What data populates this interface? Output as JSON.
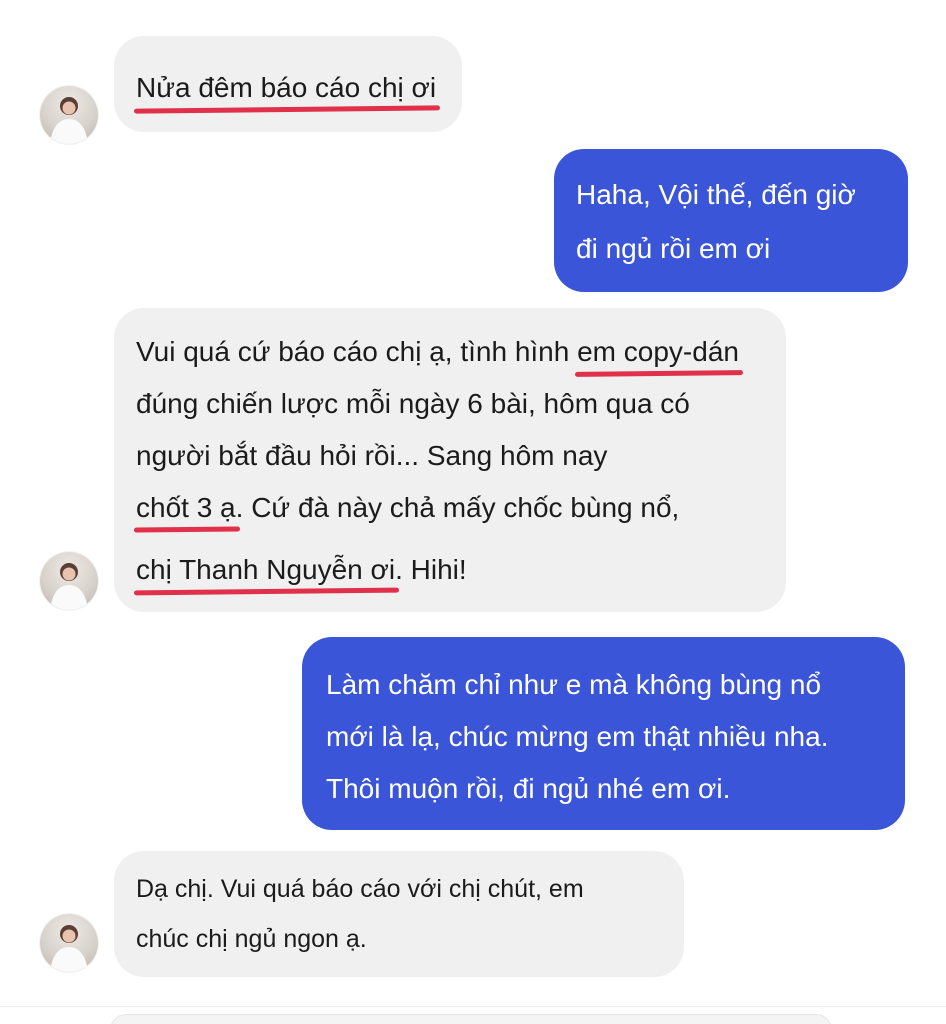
{
  "colors": {
    "incoming_bubble": "#f0f0f0",
    "outgoing_bubble": "#3a55d8",
    "underline": "#e0304a"
  },
  "messages": [
    {
      "from": "contact",
      "lines": [
        "Nửa đêm báo cáo chị ơi"
      ]
    },
    {
      "from": "me",
      "lines": [
        "Haha, Vội thế, đến giờ",
        "đi ngủ rồi em ơi"
      ]
    },
    {
      "from": "contact",
      "l1_pre": "Vui quá cứ báo cáo chị ạ, tình hình ",
      "l1_ul": "em copy-dán",
      "l2": "đúng chiến lược mỗi ngày 6 bài, hôm qua có",
      "l3": "người bắt đầu hỏi rồi... Sang hôm nay",
      "l4_ul": "chốt 3 ạ",
      "l4_post": ". Cứ đà này chả mấy chốc bùng nổ,",
      "l5_ul": "chị Thanh Nguyễn ơi",
      "l5_post": ". Hihi!"
    },
    {
      "from": "me",
      "lines": [
        "Làm chăm chỉ như e mà không bùng nổ",
        "mới là lạ, chúc mừng em thật nhiều nha.",
        "Thôi muộn rồi, đi ngủ nhé em ơi."
      ]
    },
    {
      "from": "contact",
      "lines": [
        "Dạ chị. Vui quá báo cáo với chị chút, em",
        "chúc chị ngủ ngon ạ."
      ]
    }
  ]
}
